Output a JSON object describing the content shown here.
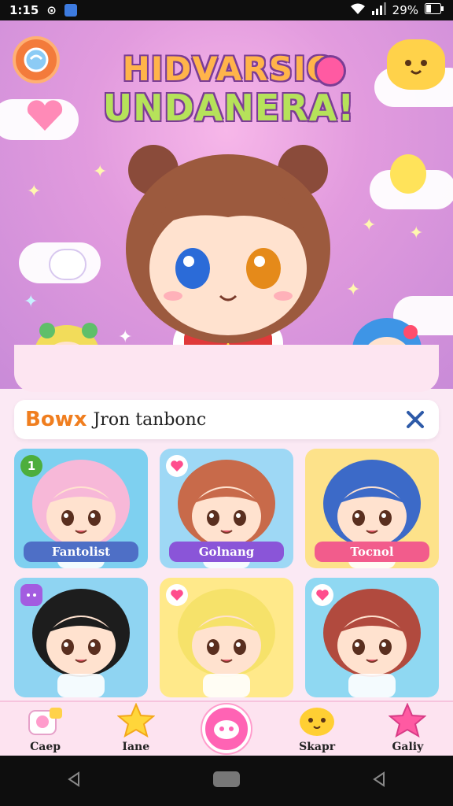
{
  "status": {
    "time": "1:15",
    "battery": "29%"
  },
  "header": {
    "title_line1": "HIDVARSIO",
    "title_line2": "UNDANERA!"
  },
  "search": {
    "bold": "Bowx",
    "rest": "Jron tanbonc"
  },
  "characters": [
    {
      "name": "Fantolist",
      "badge": "1",
      "bg": "#7ed0f0",
      "hair": "#f7b8d8",
      "skin": "#ffe2cf",
      "plate": "#4e6fc6"
    },
    {
      "name": "Golnang",
      "badge": "heart",
      "bg": "#9ed8f5",
      "hair": "#c86a4a",
      "skin": "#ffe2cf",
      "plate": "#8a55d8"
    },
    {
      "name": "Tocnol",
      "badge": "",
      "bg": "#fde28a",
      "hair": "#3c6ac8",
      "skin": "#ffe2cf",
      "plate": "#f25c8c"
    },
    {
      "name": "",
      "badge": "chat",
      "bg": "#8fd4f2",
      "hair": "#1d1d1d",
      "skin": "#ffe2cf",
      "plate": ""
    },
    {
      "name": "",
      "badge": "heart",
      "bg": "#ffe98a",
      "hair": "#f6e26a",
      "skin": "#ffe2cf",
      "plate": ""
    },
    {
      "name": "",
      "badge": "heart",
      "bg": "#8fd8f2",
      "hair": "#b14a3e",
      "skin": "#ffe2cf",
      "plate": ""
    }
  ],
  "bottom_nav": [
    {
      "label": "Caep",
      "icon": "profile-icon"
    },
    {
      "label": "Iane",
      "icon": "star-icon"
    },
    {
      "label": "",
      "icon": "home-icon"
    },
    {
      "label": "Skapr",
      "icon": "shop-icon"
    },
    {
      "label": "Galiy",
      "icon": "gallery-icon"
    }
  ],
  "colors": {
    "accent": "#ff63b4",
    "hero": "#e29bde",
    "search_bold": "#f07e1f"
  }
}
